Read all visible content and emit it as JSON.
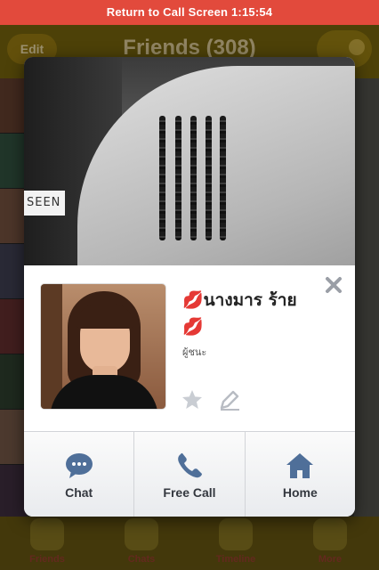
{
  "call_banner": {
    "text": "Return to Call Screen",
    "time": "1:15:54"
  },
  "background_app": {
    "edit_label": "Edit",
    "title": "Friends (308)",
    "tabs": [
      {
        "label": "Friends",
        "icon": "minion-icon"
      },
      {
        "label": "Chats",
        "icon": "minion-icon"
      },
      {
        "label": "Timeline",
        "icon": "minion-icon"
      },
      {
        "label": "More",
        "icon": "minion-icon"
      }
    ]
  },
  "profile_card": {
    "cover_watermark": "SEEN",
    "name": "💋นางมาร ร้าย💋",
    "status_message": "ผู้ชนะ",
    "actions": [
      {
        "label": "Chat",
        "icon": "chat-bubble-icon"
      },
      {
        "label": "Free Call",
        "icon": "phone-icon"
      },
      {
        "label": "Home",
        "icon": "home-icon"
      }
    ]
  },
  "colors": {
    "call_banner": "#e24a3c",
    "action_text": "#34383f",
    "icon_blue": "#4f6f99"
  }
}
